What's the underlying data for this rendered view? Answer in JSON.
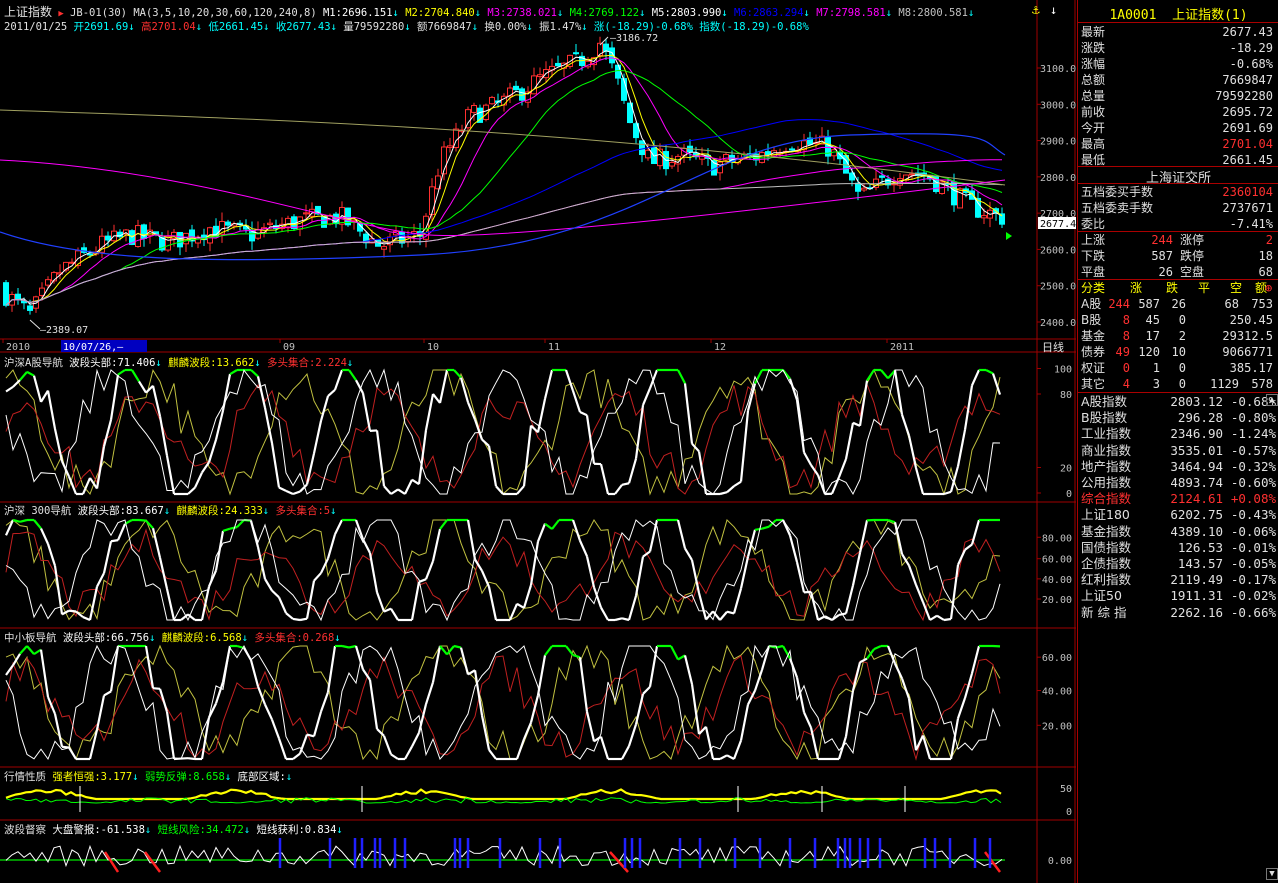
{
  "main": {
    "title": "上证指数",
    "indicator": "JB-01(30)",
    "ma_label": "MA(3,5,10,20,30,60,120,240,8)",
    "ma_values": [
      {
        "label": "M1:2696.151",
        "color": "#ffffff"
      },
      {
        "label": "M2:2704.840",
        "color": "#ffff00"
      },
      {
        "label": "M3:2738.021",
        "color": "#ff00ff"
      },
      {
        "label": "M4:2769.122",
        "color": "#00ff00"
      },
      {
        "label": "M5:2803.990",
        "color": "#ffffff"
      },
      {
        "label": "M6:2863.294",
        "color": "#0000ff"
      },
      {
        "label": "M7:2798.581",
        "color": "#ff00ff"
      },
      {
        "label": "M8:2800.581",
        "color": "#c0c0c0"
      }
    ],
    "info_line": {
      "date": "2011/01/25",
      "open": "开2691.69",
      "high": "高2701.04",
      "low": "低2661.45",
      "close": "收2677.43",
      "volume": "量79592280",
      "amount": "额7669847",
      "turnover": "换0.00%",
      "amplitude": "振1.47%",
      "change": "涨(-18.29)-0.68%",
      "index": "指数(-18.29)-0.68%"
    },
    "high_mark": "3186.72",
    "low_mark": "2389.07",
    "price_ticks": [
      "3100.0",
      "3000.0",
      "2900.0",
      "2800.0",
      "2700.0",
      "2600.0",
      "2500.0",
      "2400.0"
    ],
    "current_price_tag": "2677.4",
    "x_labels": [
      "2010",
      "09",
      "10",
      "11",
      "12",
      "2011"
    ],
    "cursor_date": "10/07/26,—",
    "period": "日线"
  },
  "panes": [
    {
      "name": "沪深A股导航",
      "items": [
        {
          "label": "波段头部:71.406",
          "color": "#ffffff"
        },
        {
          "label": "麒麟波段:13.662",
          "color": "#ffff00"
        },
        {
          "label": "多头集合:2.224",
          "color": "#ff3030"
        }
      ],
      "ticks": [
        "100",
        "80",
        "20",
        "0"
      ]
    },
    {
      "name": "沪深 300导航",
      "items": [
        {
          "label": "波段头部:83.667",
          "color": "#ffffff"
        },
        {
          "label": "麒麟波段:24.333",
          "color": "#ffff00"
        },
        {
          "label": "多头集合:5",
          "color": "#ff3030"
        }
      ],
      "ticks": [
        "80.00",
        "60.00",
        "40.00",
        "20.00"
      ]
    },
    {
      "name": "中小板导航",
      "items": [
        {
          "label": "波段头部:66.756",
          "color": "#ffffff"
        },
        {
          "label": "麒麟波段:6.568",
          "color": "#ffff00"
        },
        {
          "label": "多头集合:0.268",
          "color": "#ff3030"
        }
      ],
      "ticks": [
        "60.00",
        "40.00",
        "20.00"
      ]
    },
    {
      "name": "行情性质",
      "items": [
        {
          "label": "强者恒强:3.177",
          "color": "#ffff00"
        },
        {
          "label": "弱势反弹:8.658",
          "color": "#00ff00"
        },
        {
          "label": "底部区域:",
          "color": "#ffffff"
        }
      ],
      "ticks": [
        "50",
        "0"
      ]
    },
    {
      "name": "波段督察",
      "items": [
        {
          "label": "大盘警报:-61.538",
          "color": "#ffffff"
        },
        {
          "label": "短线风险:34.472",
          "color": "#00ff00"
        },
        {
          "label": "短线获利:0.834",
          "color": "#ffffff"
        }
      ],
      "ticks": [
        "0.00"
      ]
    }
  ],
  "right": {
    "code": "1A0001",
    "name": "上证指数(1)",
    "quote": [
      {
        "k": "最新",
        "v": "2677.43",
        "color": "#e0e0e0"
      },
      {
        "k": "涨跌",
        "v": "-18.29",
        "color": "#e0e0e0"
      },
      {
        "k": "涨幅",
        "v": "-0.68%",
        "color": "#e0e0e0"
      },
      {
        "k": "总额",
        "v": "7669847",
        "color": "#e0e0e0"
      },
      {
        "k": "总量",
        "v": "79592280",
        "color": "#e0e0e0"
      },
      {
        "k": "前收",
        "v": "2695.72",
        "color": "#e0e0e0"
      },
      {
        "k": "今开",
        "v": "2691.69",
        "color": "#e0e0e0"
      },
      {
        "k": "最高",
        "v": "2701.04",
        "color": "#ff3030"
      },
      {
        "k": "最低",
        "v": "2661.45",
        "color": "#e0e0e0"
      }
    ],
    "exchange": "上海证交所",
    "orders": [
      {
        "k": "五档委买手数",
        "v": "2360104",
        "color": "#ff3030"
      },
      {
        "k": "五档委卖手数",
        "v": "2737671",
        "color": "#e0e0e0"
      },
      {
        "k": "委比",
        "v": "-7.41%",
        "color": "#e0e0e0"
      }
    ],
    "breadth": [
      {
        "k1": "上涨",
        "v1": "244",
        "c1": "#ff3030",
        "k2": "涨停",
        "v2": "2",
        "c2": "#ff3030"
      },
      {
        "k1": "下跌",
        "v1": "587",
        "c1": "#e0e0e0",
        "k2": "跌停",
        "v2": "18",
        "c2": "#e0e0e0"
      },
      {
        "k1": "平盘",
        "v1": "26",
        "c1": "#e0e0e0",
        "k2": "空盘",
        "v2": "68",
        "c2": "#e0e0e0"
      }
    ],
    "class_header": [
      "分类",
      "涨",
      "跌",
      "平",
      "空",
      "额"
    ],
    "classes": [
      {
        "name": "A股",
        "up": "244",
        "down": "587",
        "flat": "26",
        "empty": "68",
        "amt": "753"
      },
      {
        "name": "B股",
        "up": "8",
        "down": "45",
        "flat": "0",
        "empty": "250.45",
        "amt": ""
      },
      {
        "name": "基金",
        "up": "8",
        "down": "17",
        "flat": "2",
        "empty": "29312.5",
        "amt": ""
      },
      {
        "name": "债券",
        "up": "49",
        "down": "120",
        "flat": "10",
        "empty": "9066771",
        "amt": ""
      },
      {
        "name": "权证",
        "up": "0",
        "down": "1",
        "flat": "0",
        "empty": "385.17",
        "amt": ""
      },
      {
        "name": "其它",
        "up": "4",
        "down": "3",
        "flat": "0",
        "empty": "1129",
        "amt": "578"
      }
    ],
    "indices": [
      {
        "n": "A股指数",
        "p": "2803.12",
        "c": "-0.68%",
        "red": false
      },
      {
        "n": "B股指数",
        "p": "296.28",
        "c": "-0.80%",
        "red": false
      },
      {
        "n": "工业指数",
        "p": "2346.90",
        "c": "-1.24%",
        "red": false
      },
      {
        "n": "商业指数",
        "p": "3535.01",
        "c": "-0.57%",
        "red": false
      },
      {
        "n": "地产指数",
        "p": "3464.94",
        "c": "-0.32%",
        "red": false
      },
      {
        "n": "公用指数",
        "p": "4893.74",
        "c": "-0.60%",
        "red": false
      },
      {
        "n": "综合指数",
        "p": "2124.61",
        "c": "+0.08%",
        "red": true
      },
      {
        "n": "上证180",
        "p": "6202.75",
        "c": "-0.43%",
        "red": false
      },
      {
        "n": "基金指数",
        "p": "4389.10",
        "c": "-0.06%",
        "red": false
      },
      {
        "n": "国债指数",
        "p": "126.53",
        "c": "-0.01%",
        "red": false
      },
      {
        "n": "企债指数",
        "p": "143.57",
        "c": "-0.05%",
        "red": false
      },
      {
        "n": "红利指数",
        "p": "2119.49",
        "c": "-0.17%",
        "red": false
      },
      {
        "n": "上证50",
        "p": "1911.31",
        "c": "-0.02%",
        "red": false
      },
      {
        "n": "新 综 指",
        "p": "2262.16",
        "c": "-0.66%",
        "red": false
      }
    ]
  }
}
